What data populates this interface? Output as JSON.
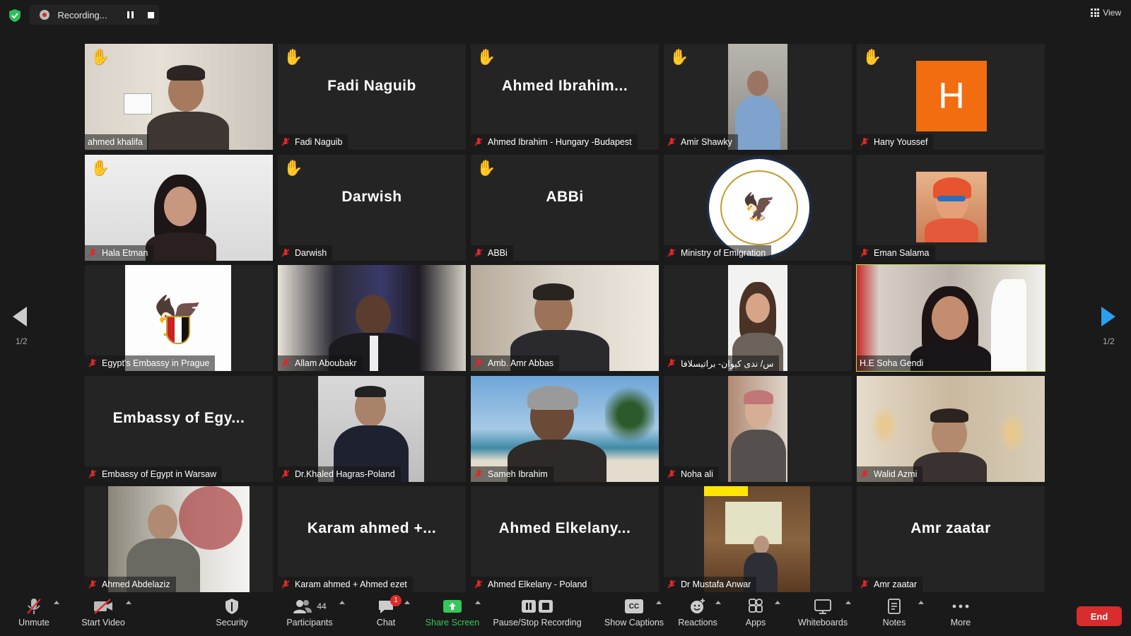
{
  "topbar": {
    "recording_text": "Recording...",
    "view_label": "View"
  },
  "pagination": {
    "left": "1/2",
    "right": "1/2"
  },
  "tiles": [
    {
      "name": "ahmed khalifa",
      "hand": true,
      "display": "",
      "kind": "video"
    },
    {
      "name": "Fadi Naguib",
      "hand": true,
      "display": "Fadi Naguib",
      "kind": "name"
    },
    {
      "name": "Ahmed Ibrahim - Hungary -Budapest",
      "hand": true,
      "display": "Ahmed  Ibrahim...",
      "kind": "name"
    },
    {
      "name": "Amir Shawky",
      "hand": true,
      "display": "",
      "kind": "video"
    },
    {
      "name": "Hany Youssef",
      "hand": true,
      "display": "",
      "kind": "avatar",
      "avatar_letter": "H"
    },
    {
      "name": "Hala Etman",
      "hand": true,
      "display": "",
      "kind": "video"
    },
    {
      "name": "Darwish",
      "hand": true,
      "display": "Darwish",
      "kind": "name"
    },
    {
      "name": "ABBi",
      "hand": true,
      "display": "ABBi",
      "kind": "name"
    },
    {
      "name": "Ministry of Emigration",
      "hand": false,
      "display": "",
      "kind": "logo"
    },
    {
      "name": "Eman Salama",
      "hand": false,
      "display": "",
      "kind": "video"
    },
    {
      "name": "Egypt's Embassy in Prague",
      "hand": false,
      "display": "",
      "kind": "emblem"
    },
    {
      "name": "Allam Aboubakr",
      "hand": false,
      "display": "",
      "kind": "video"
    },
    {
      "name": "Amb. Amr Abbas",
      "hand": false,
      "display": "",
      "kind": "video"
    },
    {
      "name": "س/ ندى كيوان- براتيسلافا",
      "hand": false,
      "display": "",
      "kind": "video"
    },
    {
      "name": "H.E Soha Gendi",
      "hand": false,
      "display": "",
      "kind": "video",
      "active": true
    },
    {
      "name": "Embassy of Egypt in Warsaw",
      "hand": false,
      "display": "Embassy  of  Egy...",
      "kind": "name"
    },
    {
      "name": "Dr.Khaled Hagras-Poland",
      "hand": false,
      "display": "",
      "kind": "video"
    },
    {
      "name": "Sameh Ibrahim",
      "hand": false,
      "display": "",
      "kind": "video"
    },
    {
      "name": "Noha ali",
      "hand": false,
      "display": "",
      "kind": "video"
    },
    {
      "name": "Walid Azmi",
      "hand": false,
      "display": "",
      "kind": "video"
    },
    {
      "name": "Ahmed Abdelaziz",
      "hand": false,
      "display": "",
      "kind": "video"
    },
    {
      "name": "Karam ahmed + Ahmed ezet",
      "hand": false,
      "display": "Karam  ahmed  +...",
      "kind": "name"
    },
    {
      "name": "Ahmed Elkelany - Poland",
      "hand": false,
      "display": "Ahmed  Elkelany...",
      "kind": "name"
    },
    {
      "name": "Dr Mustafa Anwar",
      "hand": false,
      "display": "",
      "kind": "video"
    },
    {
      "name": "Amr zaatar",
      "hand": false,
      "display": "Amr  zaatar",
      "kind": "name"
    }
  ],
  "toolbar": {
    "unmute": "Unmute",
    "start_video": "Start Video",
    "security": "Security",
    "participants": "Participants",
    "participants_count": "44",
    "chat": "Chat",
    "chat_badge": "1",
    "share_screen": "Share Screen",
    "pause_stop_recording": "Pause/Stop Recording",
    "show_captions": "Show Captions",
    "captions_icon_text": "CC",
    "reactions": "Reactions",
    "apps": "Apps",
    "whiteboards": "Whiteboards",
    "notes": "Notes",
    "more": "More",
    "end": "End"
  },
  "colors": {
    "accent_active_border": "#c5de52",
    "share_green": "#34c759",
    "end_red": "#d92c2c",
    "avatar_orange": "#f26d10",
    "nav_blue": "#2aa0ef"
  }
}
